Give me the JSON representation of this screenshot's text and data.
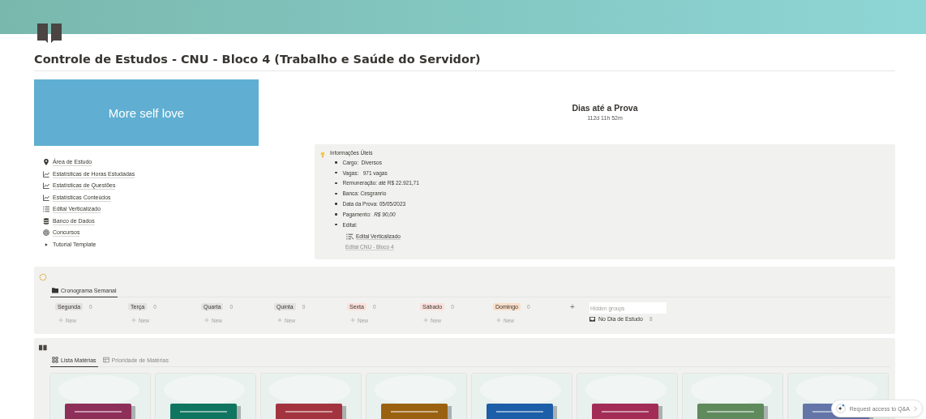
{
  "page": {
    "title": "Controle de Estudos - CNU - Bloco 4 (Trabalho e Saúde do Servidor)",
    "embed_text": "More self love"
  },
  "countdown": {
    "title": "Dias até a Prova",
    "value": "112d 11h 52m"
  },
  "links": [
    {
      "label": "Área de Estudo",
      "kind": "pin"
    },
    {
      "label": "Estatísticas de Horas Estudadas",
      "kind": "chart"
    },
    {
      "label": "Estatísticas de Questões",
      "kind": "chart"
    },
    {
      "label": "Estatísticas Conteúdos",
      "kind": "chart"
    },
    {
      "label": "Edital Verticalizado",
      "kind": "list"
    },
    {
      "label": "Banco de Dados",
      "kind": "database"
    },
    {
      "label": "Concursos",
      "kind": "target"
    },
    {
      "label": "Tutorial Template",
      "kind": "toggle"
    }
  ],
  "callout": {
    "title": "Informações Úteis",
    "items": [
      "Cargo:  Diversos",
      "Vagas:   971 vagas",
      "Remuneração: até R$ 22.921,71",
      "Banca: Cesgranrio",
      "Data da Prova: 05/05/2023",
      "Pagamento:  *R$ 90,00*",
      "Edital:"
    ],
    "edital_link": "Edital Verticalizado",
    "edital_file": "Edital CNU - Bloco 4"
  },
  "board": {
    "tab": "Cronograma Semanal",
    "groups": [
      {
        "name": "Segunda",
        "count": "0",
        "new": "New",
        "color": "#e3e2e0"
      },
      {
        "name": "Terça",
        "count": "0",
        "new": "New",
        "color": "#e3e2e0"
      },
      {
        "name": "Quarta",
        "count": "0",
        "new": "New",
        "color": "#e3e2e0"
      },
      {
        "name": "Quinta",
        "count": "0",
        "new": "New",
        "color": "#e3e2e0"
      },
      {
        "name": "Sexta",
        "count": "0",
        "new": "New",
        "color": "#fbe0dc"
      },
      {
        "name": "Sábado",
        "count": "0",
        "new": "New",
        "color": "#fbe0dc"
      },
      {
        "name": "Domingo",
        "count": "0",
        "new": "New",
        "color": "#fadec9"
      }
    ],
    "add": "+",
    "hidden_title": "Hidden groups",
    "hidden": [
      {
        "name": "No Dia de Estudo",
        "count": "8"
      }
    ]
  },
  "gallery": {
    "tabs": [
      {
        "label": "Lista Matérias",
        "selected": true
      },
      {
        "label": "Prioridade de Matérias",
        "selected": false
      }
    ],
    "cards": [
      {
        "color": "#8e2f5a"
      },
      {
        "color": "#0f7560"
      },
      {
        "color": "#a3343f"
      },
      {
        "color": "#9a6210"
      },
      {
        "color": "#1c5ea8"
      },
      {
        "color": "#a22c55"
      },
      {
        "color": "#5e8a5c"
      },
      {
        "color": "#6476a8"
      }
    ]
  },
  "qa_button": "Request access to Q&A"
}
